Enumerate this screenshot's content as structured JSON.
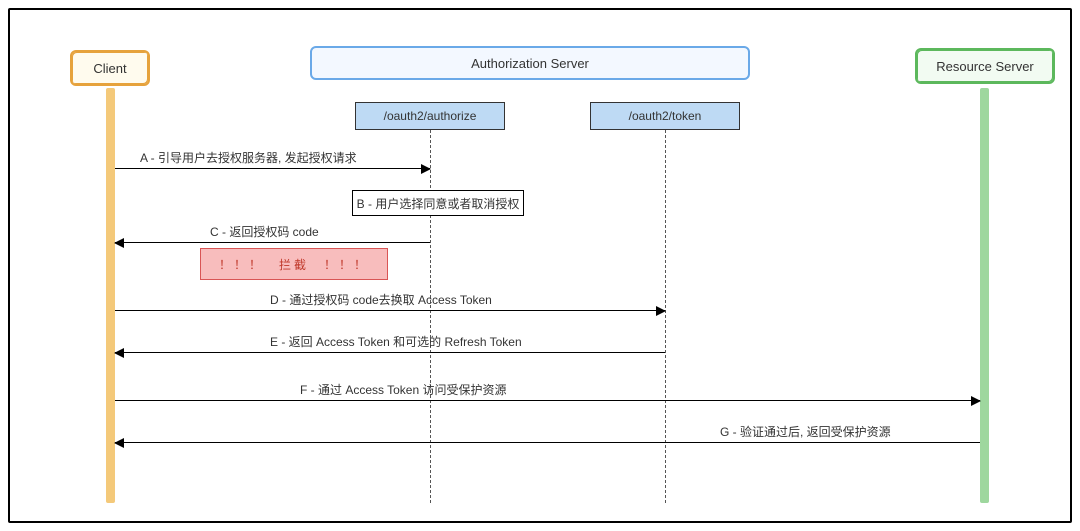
{
  "actors": {
    "client": "Client",
    "authserver": "Authorization Server",
    "resource": "Resource Server"
  },
  "endpoints": {
    "authorize": "/oauth2/authorize",
    "token": "/oauth2/token"
  },
  "messages": {
    "a": "A - 引导用户去授权服务器, 发起授权请求",
    "b": "B - 用户选择同意或者取消授权",
    "c": "C - 返回授权码 code",
    "intercept": "！！！　拦截　！！！",
    "d": "D - 通过授权码 code去换取 Access Token",
    "e": "E - 返回 Access Token 和可选的 Refresh Token",
    "f": "F - 通过 Access Token 访问受保护资源",
    "g": "G - 验证通过后, 返回受保护资源"
  },
  "chart_data": {
    "type": "sequence-diagram",
    "lifelines": [
      "Client",
      "/oauth2/authorize",
      "/oauth2/token",
      "Resource Server"
    ],
    "steps": [
      {
        "id": "A",
        "from": "Client",
        "to": "/oauth2/authorize",
        "text": "A - 引导用户去授权服务器, 发起授权请求"
      },
      {
        "id": "B",
        "self": "/oauth2/authorize",
        "text": "B - 用户选择同意或者取消授权"
      },
      {
        "id": "C",
        "from": "/oauth2/authorize",
        "to": "Client",
        "text": "C - 返回授权码 code",
        "note": "！！！ 拦截 ！！！"
      },
      {
        "id": "D",
        "from": "Client",
        "to": "/oauth2/token",
        "text": "D - 通过授权码 code去换取 Access Token"
      },
      {
        "id": "E",
        "from": "/oauth2/token",
        "to": "Client",
        "text": "E - 返回 Access Token 和可选的 Refresh Token"
      },
      {
        "id": "F",
        "from": "Client",
        "to": "Resource Server",
        "text": "F - 通过 Access Token 访问受保护资源"
      },
      {
        "id": "G",
        "from": "Resource Server",
        "to": "Client",
        "text": "G - 验证通过后, 返回受保护资源"
      }
    ]
  }
}
